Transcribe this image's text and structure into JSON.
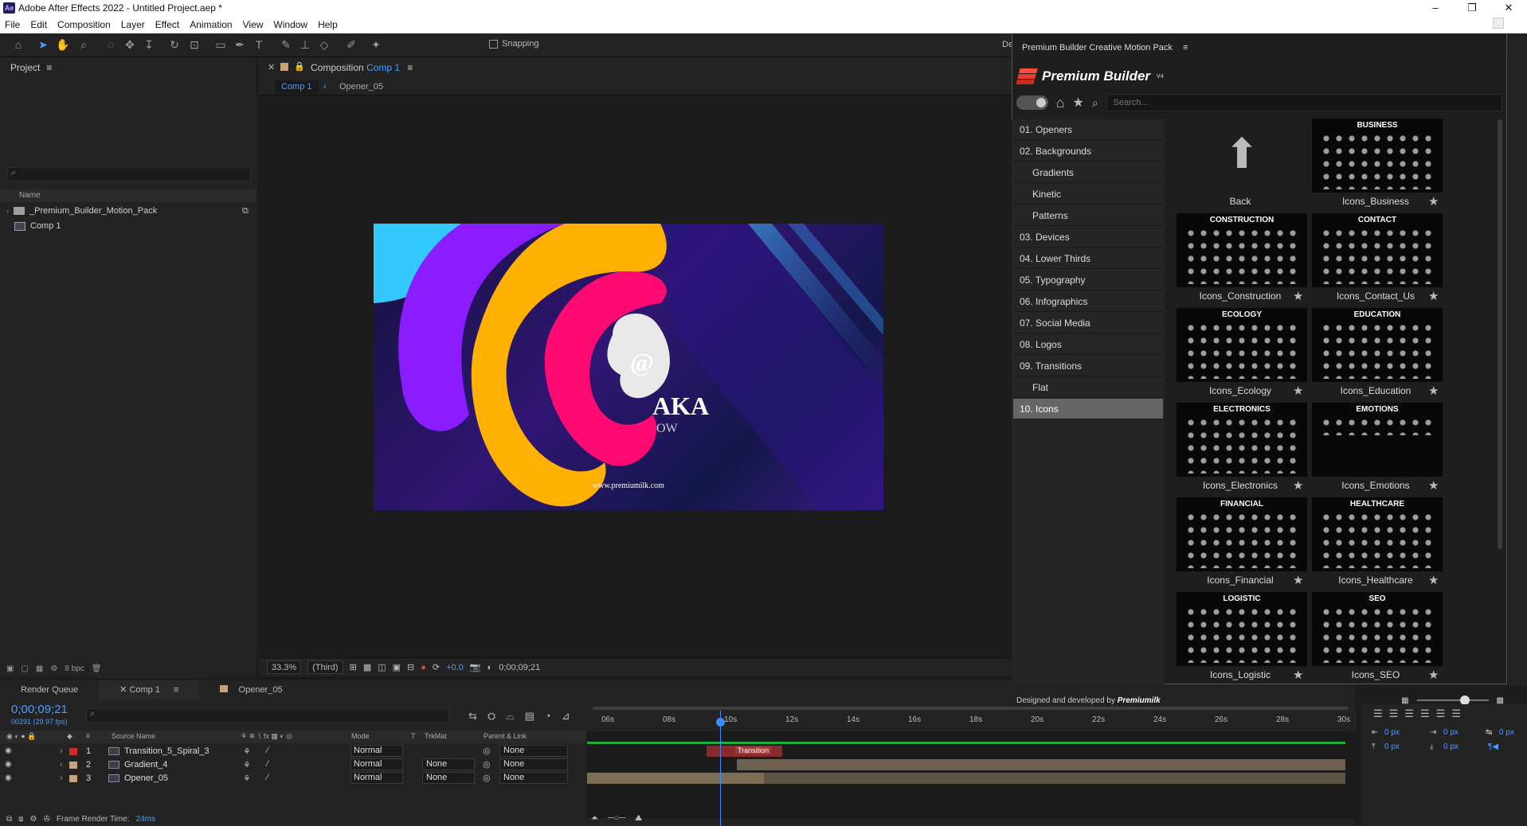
{
  "window": {
    "app_icon": "Ae",
    "title": "Adobe After Effects 2022 - Untitled Project.aep *",
    "controls": [
      "–",
      "❐",
      "✕"
    ]
  },
  "menu": [
    "File",
    "Edit",
    "Composition",
    "Layer",
    "Effect",
    "Animation",
    "View",
    "Window",
    "Help"
  ],
  "toolbar": {
    "snapping_label": "Snapping",
    "right_cut": "De"
  },
  "project": {
    "title": "Project",
    "column_name": "Name",
    "items": [
      {
        "name": "_Premium_Builder_Motion_Pack",
        "type": "folder"
      },
      {
        "name": "Comp 1",
        "type": "comp"
      }
    ],
    "bpc": "8 bpc"
  },
  "composition": {
    "panel_label": "Composition",
    "comp_name": "Comp 1",
    "breadcrumbs": [
      "Comp 1",
      "Opener_05"
    ],
    "zoom": "33.3%",
    "resolution": "(Third)",
    "exposure": "+0.0",
    "timecode": "0;00;09;21",
    "canvas": {
      "text_top": "@",
      "text_mid": "AKA",
      "text_low": "OW",
      "url": "www.premiumilk.com"
    }
  },
  "timeline": {
    "tabs": [
      "Render Queue",
      "Comp 1",
      "Opener_05"
    ],
    "timecode": "0;00;09;21",
    "frames": "00291 (29.97 fps)",
    "columns": {
      "source": "Source Name",
      "mode": "Mode",
      "t": "T",
      "trkmat": "TrkMat",
      "parent": "Parent & Link"
    },
    "ruler": [
      "06s",
      "08s",
      "10s",
      "12s",
      "14s",
      "16s",
      "18s",
      "20s",
      "22s",
      "24s",
      "26s",
      "28s",
      "30s"
    ],
    "layers": [
      {
        "num": "1",
        "name": "Transition_5_Spiral_3",
        "color": "#c9302c",
        "mode": "Normal",
        "trkmat": "",
        "parent": "None"
      },
      {
        "num": "2",
        "name": "Gradient_4",
        "color": "#c9a27a",
        "mode": "Normal",
        "trkmat": "None",
        "parent": "None"
      },
      {
        "num": "3",
        "name": "Opener_05",
        "color": "#c9a27a",
        "mode": "Normal",
        "trkmat": "None",
        "parent": "None"
      }
    ],
    "marker_label": "Transition",
    "render_time_label": "Frame Render Time:",
    "render_time_value": "24ms"
  },
  "plugin": {
    "panel_title": "Premium Builder Creative Motion Pack",
    "brand": "Premium Builder",
    "brand_sup": "V4",
    "search_placeholder": "Search...",
    "categories": [
      {
        "label": "01. Openers",
        "sub": false,
        "active": false
      },
      {
        "label": "02. Backgrounds",
        "sub": false,
        "active": false
      },
      {
        "label": "Gradients",
        "sub": true,
        "active": false
      },
      {
        "label": "Kinetic",
        "sub": true,
        "active": false
      },
      {
        "label": "Patterns",
        "sub": true,
        "active": false
      },
      {
        "label": "03. Devices",
        "sub": false,
        "active": false
      },
      {
        "label": "04. Lower Thirds",
        "sub": false,
        "active": false
      },
      {
        "label": "05. Typography",
        "sub": false,
        "active": false
      },
      {
        "label": "06. Infographics",
        "sub": false,
        "active": false
      },
      {
        "label": "07. Social Media",
        "sub": false,
        "active": false
      },
      {
        "label": "08. Logos",
        "sub": false,
        "active": false
      },
      {
        "label": "09. Transitions",
        "sub": false,
        "active": false
      },
      {
        "label": "Flat",
        "sub": true,
        "active": false
      },
      {
        "label": "10. Icons",
        "sub": false,
        "active": true
      }
    ],
    "back_label": "Back",
    "items": [
      {
        "title": "BUSINESS",
        "label": "Icons_Business"
      },
      {
        "title": "CONSTRUCTION",
        "label": "Icons_Construction"
      },
      {
        "title": "CONTACT",
        "label": "Icons_Contact_Us"
      },
      {
        "title": "ECOLOGY",
        "label": "Icons_Ecology"
      },
      {
        "title": "EDUCATION",
        "label": "Icons_Education"
      },
      {
        "title": "ELECTRONICS",
        "label": "Icons_Electronics"
      },
      {
        "title": "EMOTIONS",
        "label": "Icons_Emotions"
      },
      {
        "title": "FINANCIAL",
        "label": "Icons_Financial"
      },
      {
        "title": "HEALTHCARE",
        "label": "Icons_Healthcare"
      },
      {
        "title": "LOGISTIC",
        "label": "Icons_Logistic"
      },
      {
        "title": "SEO",
        "label": "Icons_SEO"
      }
    ],
    "footer_text": "Designed and developed by",
    "footer_brand": "Premiumilk"
  },
  "align": {
    "x1": "0 px",
    "x2": "0 px",
    "x3": "0 px",
    "y1": "0 px",
    "y2": "0 px"
  }
}
